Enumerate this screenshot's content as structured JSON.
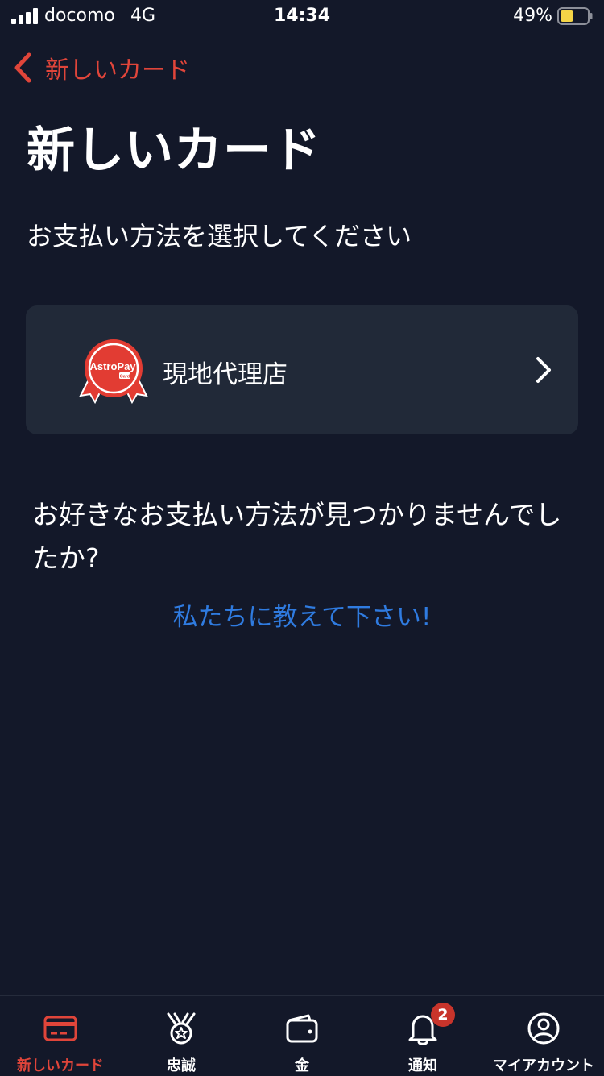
{
  "status_bar": {
    "carrier": "docomo",
    "network": "4G",
    "time": "14:34",
    "battery": "49%",
    "battery_level": 0.49
  },
  "nav": {
    "back_label": "新しいカード",
    "back_icon": "chevron-left-icon"
  },
  "page": {
    "title": "新しいカード",
    "subtitle": "お支払い方法を選択してください"
  },
  "methods": [
    {
      "label": "現地代理店",
      "logo_text": "AstroPay",
      "logo_subtext": "Card",
      "icon": "chevron-right-icon"
    }
  ],
  "help": {
    "question": "お好きなお支払い方法が見つかりませんでしたか?",
    "link": "私たちに教えて下さい!"
  },
  "tabs": [
    {
      "label": "新しいカード",
      "icon": "credit-card-icon",
      "active": true
    },
    {
      "label": "忠誠",
      "icon": "medal-icon",
      "active": false
    },
    {
      "label": "金",
      "icon": "wallet-icon",
      "active": false
    },
    {
      "label": "通知",
      "icon": "bell-icon",
      "active": false,
      "badge": "2"
    },
    {
      "label": "マイアカウント",
      "icon": "user-circle-icon",
      "active": false
    }
  ],
  "colors": {
    "background": "#131829",
    "card": "#212938",
    "accent": "#e0453a",
    "link": "#2f7be0",
    "battery": "#f5d547"
  }
}
